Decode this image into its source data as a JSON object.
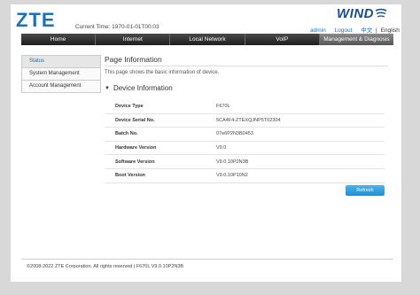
{
  "header": {
    "logo": "ZTE",
    "current_time": "Current Time: 1970-01-01T00:03",
    "brand": "WIND",
    "links": {
      "admin": "admin",
      "logout": "Logout",
      "chinese": "中文",
      "english": "English",
      "sep": "|"
    }
  },
  "nav": {
    "items": [
      "Home",
      "Internet",
      "Local Network",
      "VoIP",
      "Management & Diagnosis"
    ],
    "active_index": 4
  },
  "sidebar": {
    "items": [
      "Status",
      "System Management",
      "Account Management"
    ],
    "active_index": 0
  },
  "main": {
    "title": "Page Information",
    "description": "This page shows the basic information of device.",
    "section": "Device Information",
    "rows": [
      {
        "label": "Device Type",
        "value": "F670L"
      },
      {
        "label": "Device Serial No.",
        "value": "5CA4F4-ZTEXQJNP5T02304"
      },
      {
        "label": "Batch No.",
        "value": "07e6P2N3B0453"
      },
      {
        "label": "Hardware Version",
        "value": "V9.0"
      },
      {
        "label": "Software Version",
        "value": "V9.0.10P2N3B"
      },
      {
        "label": "Boot Version",
        "value": "V9.0.10P10N2"
      }
    ],
    "refresh_label": "Refresh"
  },
  "footer": {
    "text": "©2008-2022 ZTE Corporation. All rights reserved  |  F670L V9.0.10P2N3B"
  },
  "colors": {
    "accent": "#1d6fb8",
    "nav_bg": "#2b2b2b",
    "refresh": "#2a9ee0"
  }
}
